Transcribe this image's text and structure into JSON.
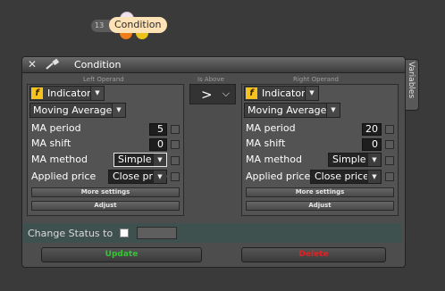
{
  "node": {
    "id": "13",
    "label": "Condition"
  },
  "dialog": {
    "title": "Condition",
    "side_tab": "Variables"
  },
  "left_header": "Left Operand",
  "right_header": "Right Operand",
  "comparison": {
    "header": "Is Above",
    "operator": ">"
  },
  "left": {
    "source": "Indicator",
    "indicator": "Moving Average",
    "fields": {
      "ma_period": {
        "label": "MA period",
        "value": "5"
      },
      "ma_shift": {
        "label": "MA shift",
        "value": "0"
      },
      "ma_method": {
        "label": "MA method",
        "value": "Simple"
      },
      "applied_price": {
        "label": "Applied price",
        "value": "Close price"
      }
    },
    "more_settings": "More settings",
    "adjust": "Adjust"
  },
  "right": {
    "source": "Indicator",
    "indicator": "Moving Average",
    "fields": {
      "ma_period": {
        "label": "MA period",
        "value": "20"
      },
      "ma_shift": {
        "label": "MA shift",
        "value": "0"
      },
      "ma_method": {
        "label": "MA method",
        "value": "Simple"
      },
      "applied_price": {
        "label": "Applied price",
        "value": "Close price"
      }
    },
    "more_settings": "More settings",
    "adjust": "Adjust"
  },
  "change_status": {
    "label": "Change Status to",
    "checked": false
  },
  "buttons": {
    "update": "Update",
    "delete": "Delete"
  },
  "colors": {
    "background": "#3a3a3a",
    "node_label": "#fde2b5",
    "node_dot_left": "#ee7d1a",
    "node_dot_right": "#ecc21a",
    "fx_icon": "#f6c21d",
    "status_row": "#3f514f",
    "update_text": "#37c437",
    "delete_text": "#e22222"
  },
  "icons": {
    "close": "close-icon",
    "pin": "pin-icon",
    "source": "function-icon"
  }
}
